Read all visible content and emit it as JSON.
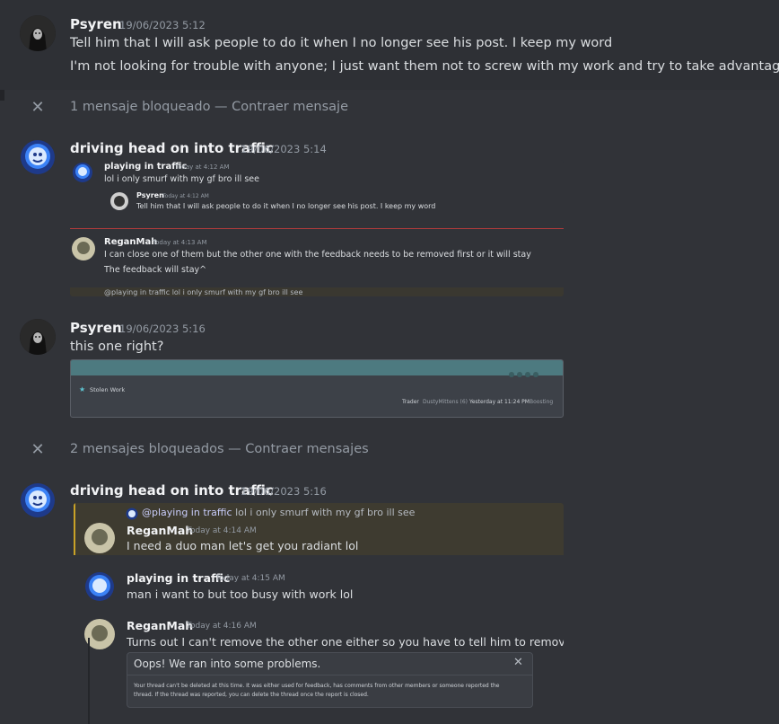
{
  "messages": {
    "m1": {
      "username": "Psyren",
      "timestamp": "19/06/2023 5:12",
      "lines": [
        "Tell him that I will ask people to do it when I no longer see his post. I keep my word",
        "I'm not looking for trouble with anyone; I just want them not to screw with my work and try to take advantage."
      ]
    },
    "blocked1": {
      "text": "1 mensaje bloqueado — ",
      "link": "Contraer mensaje"
    },
    "m2": {
      "username": "driving head on into traffic",
      "timestamp": "19/06/2023 5:14",
      "embed": {
        "a_name": "playing in traffic",
        "a_ts": "Today at 4:12 AM",
        "a_text": "lol i only smurf with my gf bro ill see",
        "quote_name": "Psyren",
        "quote_ts": "Today at 4:12 AM",
        "quote_text": "Tell him that I will ask people to do it when I no longer see his post. I keep my word",
        "b_name": "ReganMah",
        "b_ts": "Today at 4:13 AM",
        "b_line1": "I can close one of them but the other one with the feedback needs to be removed first or it will stay",
        "b_line2": "The feedback will stay^",
        "reply_preview": "@playing in traffic lol i only smurf with my gf bro ill see"
      }
    },
    "m3": {
      "username": "Psyren",
      "timestamp": "19/06/2023 5:16",
      "text": "this one right?",
      "embed": {
        "thread_title": "Stolen Work",
        "meta": [
          "Trader",
          "DustyMittens (6)",
          "Yesterday at 11:24 PM",
          "Boosting"
        ]
      }
    },
    "blocked2": {
      "text": "2 mensajes bloqueados — ",
      "link": "Contraer mensajes"
    },
    "m4": {
      "username": "driving head on into traffic",
      "timestamp": "19/06/2023 5:16",
      "embed": {
        "reply_mention": "@playing in traffic",
        "reply_text": " lol i only smurf with my gf bro ill see",
        "c_name": "ReganMah",
        "c_ts": "Today at 4:14 AM",
        "c_text": "I need a duo man let's get you radiant lol",
        "d_name": "playing in traffic",
        "d_ts": "Today at 4:15 AM",
        "d_text": "man i want to but too busy with work lol",
        "e_name": "ReganMah",
        "e_ts": "Today at 4:16 AM",
        "e_text": "Turns out I can't remove the other one either so you have to tell him to remove it first",
        "error_title": "Oops! We ran into some problems.",
        "error_line1": "Your thread can't be deleted at this time. It was either used for feedback, has comments from other members or someone reported the",
        "error_line2": "thread. If the thread was reported, you can delete the thread once the report is closed."
      }
    }
  }
}
